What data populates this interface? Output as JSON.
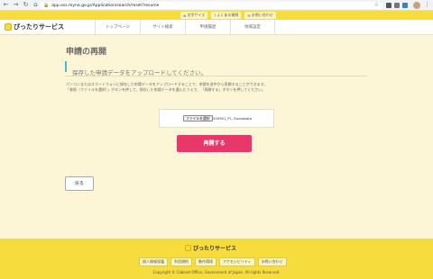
{
  "browser": {
    "url": "app.oss.myna.go.jp/Application/search/reset?resume",
    "back_icon": "arrow-left",
    "forward_icon": "arrow-right",
    "reload_icon": "reload",
    "home_icon": "home"
  },
  "header": {
    "site_name": "ぴったりサービス",
    "top_links": [
      "文字サイズ",
      "よくある質問",
      "お問い合わせ"
    ],
    "nav": [
      "トップページ",
      "サイト検索",
      "申請履歴",
      "地域設定"
    ]
  },
  "main": {
    "title": "申請の再開",
    "subtitle": "保存した申請データをアップロードしてください。",
    "description_lines": [
      "パソコンまたはスマートフォンに保存した申請データをアップロードすることで、申請を途中から再開することができます。",
      "「参照（ファイルを選択）」ボタンを押して、保存した申請データを選んだうえで、「再開する」ボタンを押してください。"
    ],
    "file_button_label": "ファイルを選択",
    "file_name": "200901_Pi...Sovokoata",
    "resume_button": "再開する",
    "back_button": "戻る"
  },
  "footer": {
    "site_name": "ぴったりサービス",
    "links": [
      "個人情報保護",
      "利用規約",
      "動作環境",
      "アクセシビリティ",
      "お問い合わせ"
    ],
    "copyright": "Copyright © Cabinet Office, Government of Japan. All rights Reserved."
  },
  "colors": {
    "accent_yellow": "#f6dc3d",
    "background": "#fdf6d6",
    "primary_button": "#e8386a",
    "subtitle_bar": "#49b8d2"
  }
}
